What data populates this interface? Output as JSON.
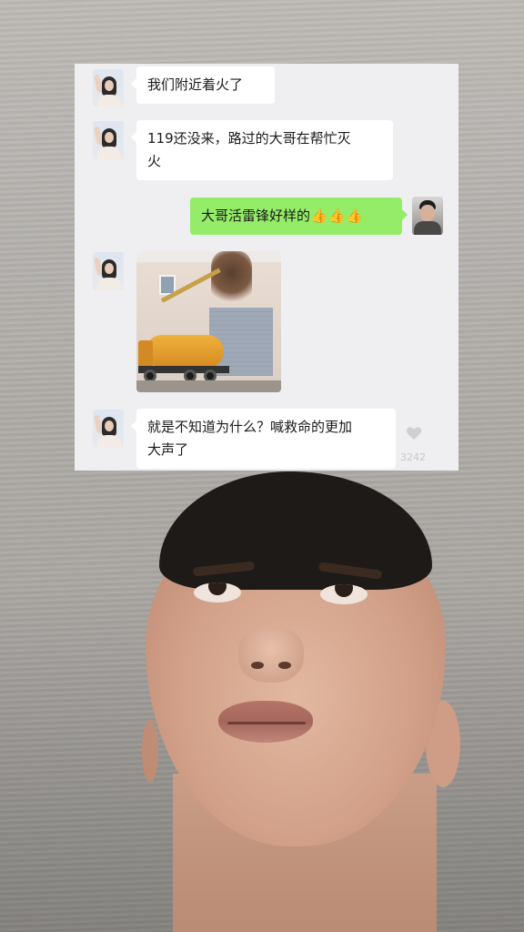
{
  "chat": {
    "messages": [
      {
        "side": "left",
        "sender": "female-avatar",
        "text": "我们附近着火了"
      },
      {
        "side": "left",
        "sender": "female-avatar",
        "text_line1": "119还没来，路过的大哥在帮忙灭",
        "text_line2": "火"
      },
      {
        "side": "right",
        "sender": "male-avatar",
        "text": "大哥活雷锋好样的",
        "emoji": "👍👍👍"
      },
      {
        "side": "left",
        "sender": "female-avatar",
        "type": "image",
        "image_description_icon": "tanker-truck-fire-photo"
      },
      {
        "side": "left",
        "sender": "female-avatar",
        "text_line1": "就是不知道为什么？喊救命的更加",
        "text_line2": "大声了"
      }
    ],
    "like_count": "3242"
  },
  "colors": {
    "chat_background": "#efeff2",
    "incoming_bubble": "#ffffff",
    "outgoing_bubble": "#95ec69",
    "like_icon": "#d0d0d4"
  }
}
